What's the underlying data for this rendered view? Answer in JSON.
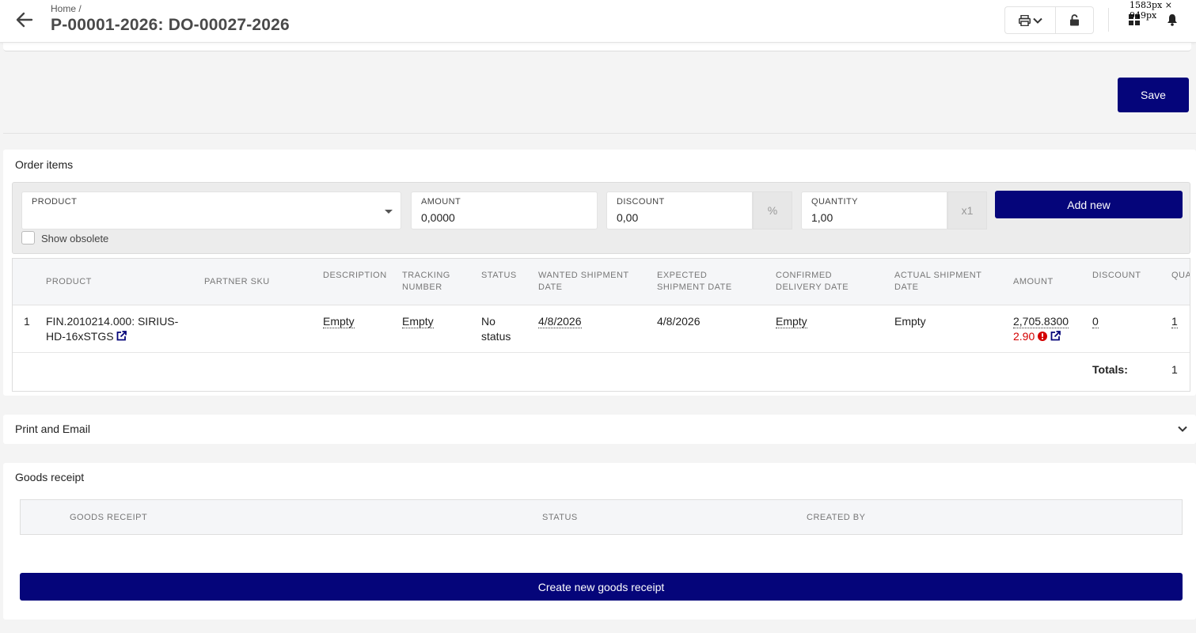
{
  "header": {
    "breadcrumb": "Home  /",
    "title": "P-00001-2026: DO-00027-2026",
    "dimensions_label": "1583px × 949px",
    "icons": [
      "back-arrow-icon",
      "printer-icon",
      "chevron-down-icon",
      "unlock-icon",
      "grid-icon",
      "bell-icon"
    ]
  },
  "actions": {
    "save_label": "Save"
  },
  "order_items": {
    "title": "Order items",
    "entry": {
      "product_label": "PRODUCT",
      "product_value": "",
      "amount_label": "AMOUNT",
      "amount_value": "0,0000",
      "discount_label": "DISCOUNT",
      "discount_value": "0,00",
      "discount_suffix": "%",
      "quantity_label": "QUANTITY",
      "quantity_value": "1,00",
      "quantity_suffix": "x1",
      "add_label": "Add new",
      "show_obsolete_label": "Show obsolete",
      "show_obsolete_checked": false
    },
    "columns": {
      "product": "PRODUCT",
      "partner_sku": "PARTNER SKU",
      "description": "DESCRIPTION",
      "tracking_1": "TRACKING",
      "tracking_2": "NUMBER",
      "status": "STATUS",
      "wanted_1": "WANTED SHIPMENT",
      "wanted_2": "DATE",
      "expected_1": "EXPECTED",
      "expected_2": "SHIPMENT DATE",
      "confirmed_1": "CONFIRMED",
      "confirmed_2": "DELIVERY DATE",
      "actual_1": "ACTUAL SHIPMENT",
      "actual_2": "DATE",
      "amount": "AMOUNT",
      "discount": "DISCOUNT",
      "quantity": "QUA"
    },
    "rows": [
      {
        "index": "1",
        "product_line1": "FIN.2010214.000: SIRIUS-",
        "product_line2": "HD-16xSTGS",
        "partner_sku": "",
        "description": "Empty",
        "tracking_number": "Empty",
        "status_line1": "No",
        "status_line2": "status",
        "wanted_shipment_date": "4/8/2026",
        "expected_shipment_date": "4/8/2026",
        "confirmed_delivery_date": "Empty",
        "actual_shipment_date": "Empty",
        "amount": "2,705.8300",
        "amount_warning": "2.90",
        "discount": "0",
        "quantity": "1"
      }
    ],
    "totals_label": "Totals:",
    "totals_quantity": "1"
  },
  "print_email": {
    "title": "Print and Email"
  },
  "goods_receipt": {
    "title": "Goods receipt",
    "columns": {
      "goods_receipt": "GOODS RECEIPT",
      "status": "STATUS",
      "created_by": "CREATED BY"
    },
    "create_label": "Create new goods receipt"
  },
  "colors": {
    "primary": "#05057a",
    "warning": "#d40000",
    "background": "#f4f4f4"
  }
}
